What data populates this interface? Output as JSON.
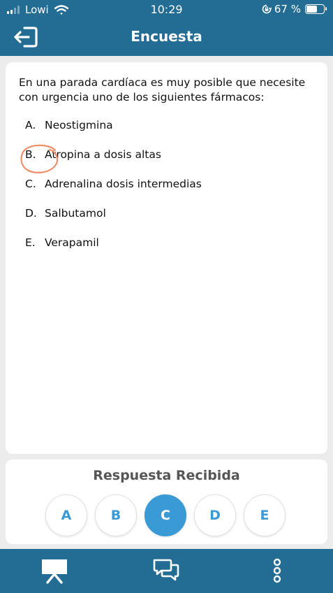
{
  "status_bar": {
    "carrier": "Lowi",
    "time": "10:29",
    "battery": "67 %",
    "battery_level": 0.67
  },
  "header": {
    "title": "Encuesta",
    "back_icon": "exit-arrow-icon"
  },
  "question": {
    "text": "En una parada cardíaca es muy posible que necesite con urgencia uno de los siguientes fármacos:",
    "options": [
      {
        "letter": "A.",
        "text": "Neostigmina"
      },
      {
        "letter": "B.",
        "text": "Atropina a dosis altas"
      },
      {
        "letter": "C.",
        "text": "Adrenalina dosis intermedias"
      },
      {
        "letter": "D.",
        "text": "Salbutamol"
      },
      {
        "letter": "E.",
        "text": "Verapamil"
      }
    ]
  },
  "answer": {
    "title": "Respuesta Recibida",
    "options": [
      "A",
      "B",
      "C",
      "D",
      "E"
    ],
    "selected": "C"
  },
  "bottom_bar": {
    "tabs": [
      "presentation-icon",
      "chat-icon",
      "more-vertical-icon"
    ]
  },
  "colors": {
    "header_bg": "#236D95",
    "accent": "#3A9AD6",
    "annotation": "#F08E6A"
  }
}
